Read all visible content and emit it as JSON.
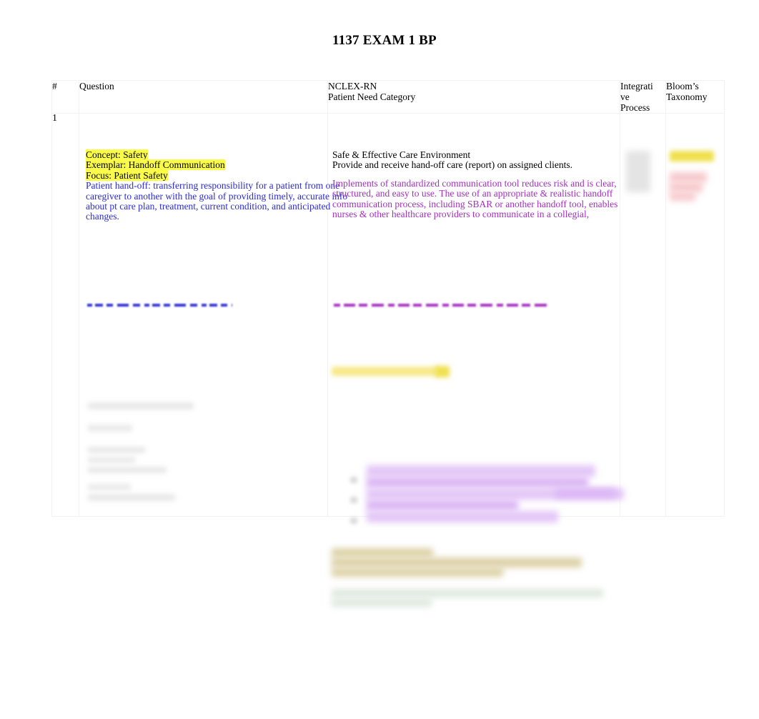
{
  "document": {
    "title": "1137 EXAM 1 BP"
  },
  "table": {
    "headers": {
      "number": "#",
      "question": "Question",
      "nclex_line1": "NCLEX-RN",
      "nclex_line2": "Patient Need Category",
      "integrative_process": "Integrative Process",
      "integrative_process_line1": "Integrati",
      "integrative_process_line2": "ve",
      "integrative_process_line3": "Process",
      "blooms_line1": "Bloom’s",
      "blooms_line2": "Taxonomy"
    },
    "rows": [
      {
        "number": "1",
        "question": {
          "highlighted_lines": [
            "Concept: Safety",
            "Exemplar: Handoff Communication",
            "Focus: Patient Safety"
          ],
          "body_lines": [
            "Patient hand-off:  transferring responsibility for a patient from one",
            "caregiver to another with the goal of providing timely, accurate info",
            "about pt care plan, treatment, current condition, and anticipated",
            "changes."
          ],
          "truncated_note": "(remaining text cut off / illegible)"
        },
        "nclex": {
          "category_lines": [
            "Safe & Effective Care Environment",
            "Provide and receive hand-off care (report) on assigned clients."
          ],
          "rationale_lines": [
            "Implements of standardized communication tool reduces risk and is clear,",
            "structured, and easy to use. The use of an appropriate & realistic handoff",
            "communication process, including SBAR or another handoff tool, enables",
            "nurses & other healthcare providers to communicate in a collegial,"
          ],
          "truncated_note": "(remaining text cut off / illegible)"
        },
        "integrative_process": "",
        "blooms_taxonomy": ""
      }
    ]
  },
  "colors": {
    "highlight_yellow": "#fbfb4a",
    "text_blue": "#2b2bd4",
    "text_purple": "#a32fbf",
    "text_black": "#000000",
    "highlight_purple": "#e3c6f7",
    "highlight_tan": "#ddd2a8",
    "highlight_green": "#dfe9df",
    "highlight_pink": "#f7c9cc",
    "border_grey": "#f2f2f2",
    "page_background": "#ffffff"
  }
}
